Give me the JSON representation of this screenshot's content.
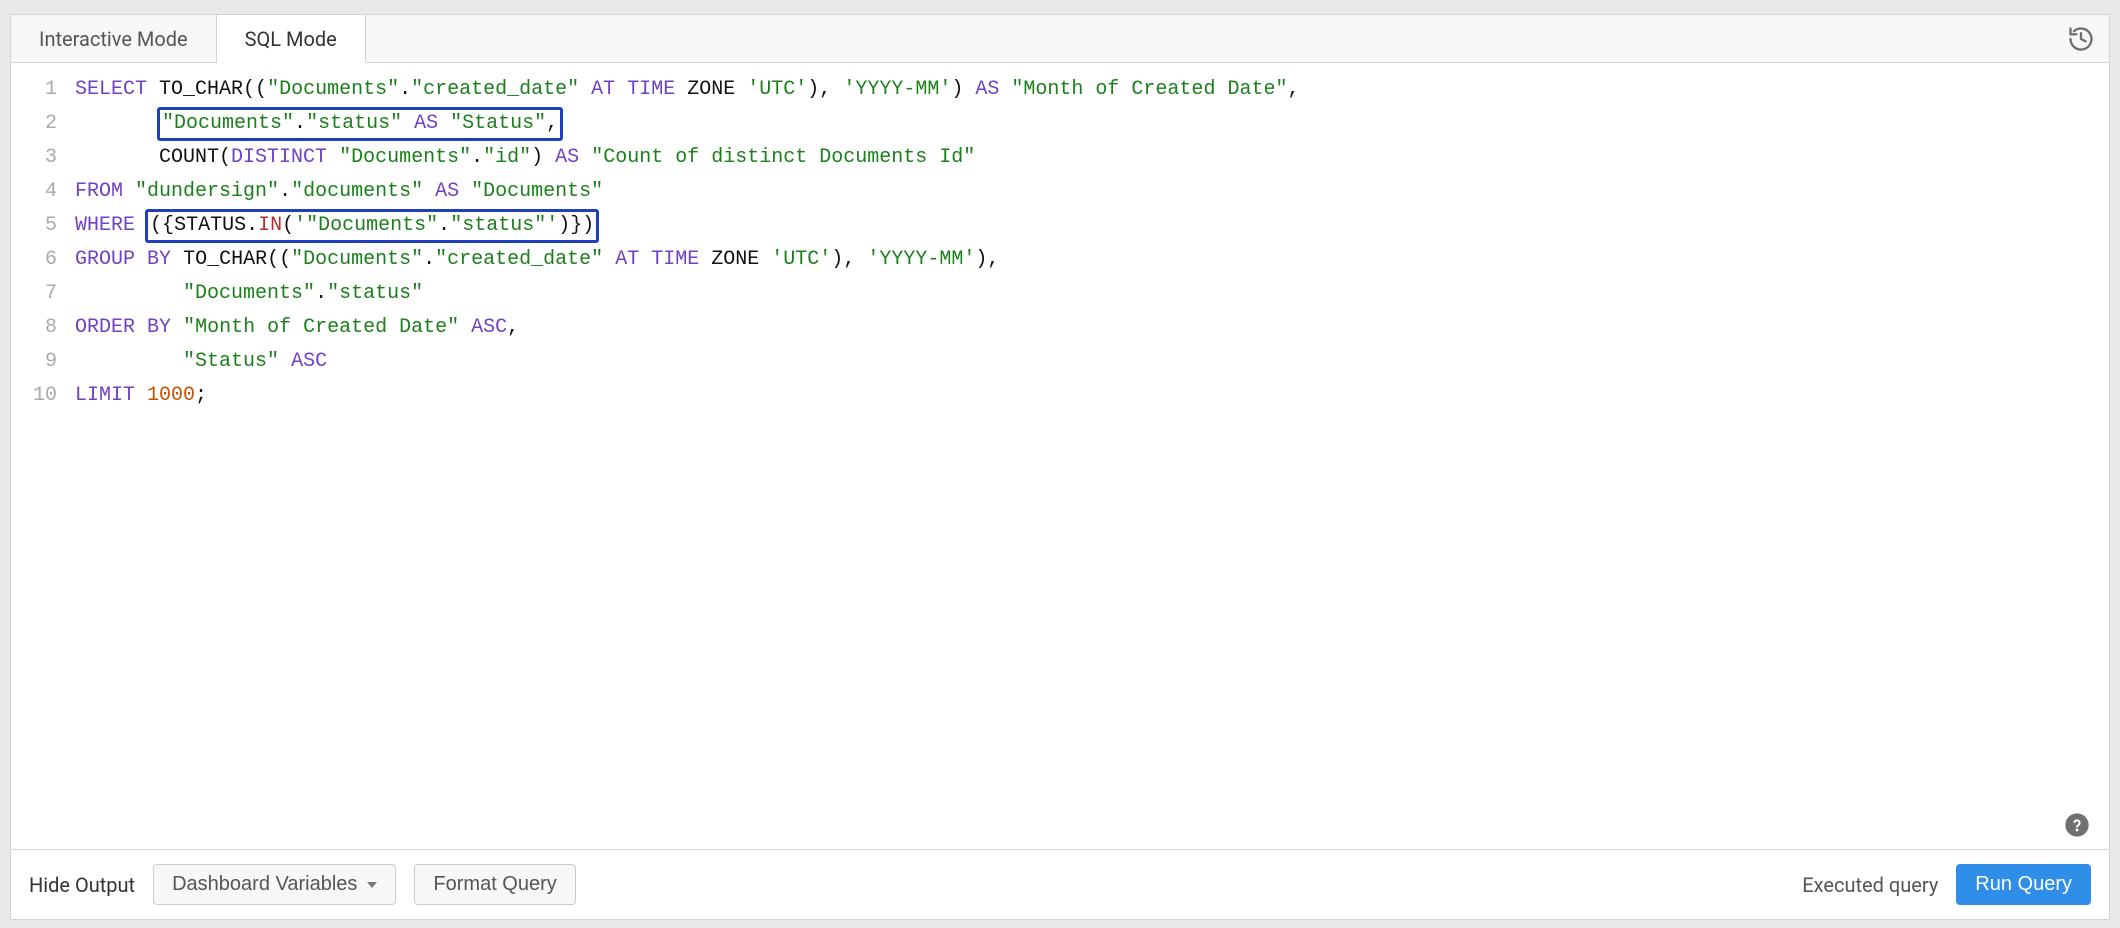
{
  "tabs": {
    "interactive": "Interactive Mode",
    "sql": "SQL Mode",
    "active": "sql"
  },
  "gutter": [
    "1",
    "2",
    "3",
    "4",
    "5",
    "6",
    "7",
    "8",
    "9",
    "10"
  ],
  "sql": {
    "l1": {
      "kw_select": "SELECT",
      "fn_tochar": "TO_CHAR",
      "p_open": "((",
      "doc": "\"Documents\"",
      "dot1": ".",
      "col1": "\"created_date\"",
      "kw_at": "AT",
      "kw_time": "TIME",
      "kw_zone": "ZONE",
      "utc": "'UTC'",
      "p_close": ")",
      "comma1": ",",
      "fmt": "'YYYY-MM'",
      "p_close2": ")",
      "kw_as": "AS",
      "alias": "\"Month of Created Date\"",
      "comma2": ","
    },
    "l2": {
      "doc": "\"Documents\"",
      "dot": ".",
      "col": "\"status\"",
      "kw_as": "AS",
      "alias": "\"Status\"",
      "comma": ","
    },
    "l3": {
      "fn_count": "COUNT",
      "p_open": "(",
      "kw_distinct": "DISTINCT",
      "doc": "\"Documents\"",
      "dot": ".",
      "col": "\"id\"",
      "p_close": ")",
      "kw_as": "AS",
      "alias": "\"Count of distinct Documents Id\""
    },
    "l4": {
      "kw_from": "FROM",
      "schema": "\"dundersign\"",
      "dot": ".",
      "tbl": "\"documents\"",
      "kw_as": "AS",
      "alias": "\"Documents\""
    },
    "l5": {
      "kw_where": "WHERE",
      "p_open": "(",
      "brace_open": "{",
      "status": "STATUS",
      "dot": ".",
      "in": "IN",
      "arg_open": "(",
      "q1": "'",
      "doc": "\"Documents\"",
      "dot2": ".",
      "col": "\"status\"",
      "q2": "'",
      "arg_close": ")",
      "brace_close": "}",
      "p_close": ")"
    },
    "l6": {
      "kw_group": "GROUP",
      "kw_by": "BY",
      "fn_tochar": "TO_CHAR",
      "p_open": "((",
      "doc": "\"Documents\"",
      "dot": ".",
      "col": "\"created_date\"",
      "kw_at": "AT",
      "kw_time": "TIME",
      "kw_zone": "ZONE",
      "utc": "'UTC'",
      "p_close": ")",
      "comma1": ",",
      "fmt": "'YYYY-MM'",
      "p_close2": ")",
      "comma2": ","
    },
    "l7": {
      "doc": "\"Documents\"",
      "dot": ".",
      "col": "\"status\""
    },
    "l8": {
      "kw_order": "ORDER",
      "kw_by": "BY",
      "col": "\"Month of Created Date\"",
      "asc": "ASC",
      "comma": ","
    },
    "l9": {
      "col": "\"Status\"",
      "asc": "ASC"
    },
    "l10": {
      "kw_limit": "LIMIT",
      "num": "1000",
      "semi": ";"
    }
  },
  "footer": {
    "hide_output": "Hide Output",
    "dashboard_vars": "Dashboard Variables",
    "format_query": "Format Query",
    "executed_query": "Executed query",
    "run_query": "Run Query"
  }
}
